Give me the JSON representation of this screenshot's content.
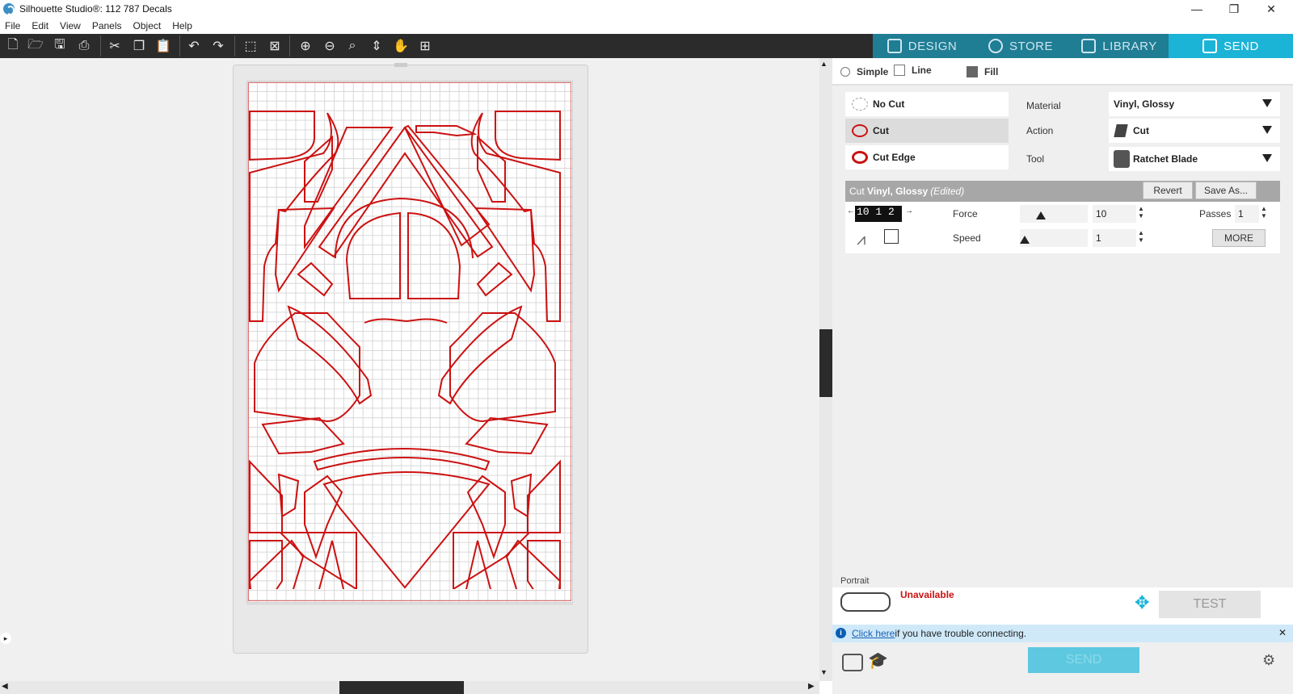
{
  "window": {
    "title": "Silhouette Studio®: 112 787 Decals",
    "minimize": "—",
    "restore": "❐",
    "close": "✕"
  },
  "menu": [
    "File",
    "Edit",
    "View",
    "Panels",
    "Object",
    "Help"
  ],
  "toolbar": {
    "icons": [
      "new-icon",
      "open-icon",
      "save-icon",
      "print-icon",
      "cut-icon",
      "copy-icon",
      "paste-icon",
      "undo-icon",
      "redo-icon",
      "select-all-icon",
      "deselect-icon",
      "zoom-in-icon",
      "zoom-out-icon",
      "zoom-fit-icon",
      "pan-down-icon",
      "hand-icon",
      "fit-page-icon"
    ]
  },
  "nav_tabs": [
    {
      "label": "DESIGN",
      "icon": "design-icon"
    },
    {
      "label": "STORE",
      "icon": "store-icon"
    },
    {
      "label": "LIBRARY",
      "icon": "library-icon"
    },
    {
      "label": "SEND",
      "icon": "send-icon",
      "active": true
    }
  ],
  "send_panel": {
    "modes": [
      "Simple",
      "Line",
      "Fill"
    ],
    "cut_types": [
      "No Cut",
      "Cut",
      "Cut Edge"
    ],
    "selected_cut_type": "Cut",
    "labels": {
      "material": "Material",
      "action": "Action",
      "tool": "Tool"
    },
    "material": "Vinyl, Glossy",
    "action": "Cut",
    "tool": "Ratchet Blade",
    "cut_bar_prefix": "Cut ",
    "cut_bar_material": "Vinyl, Glossy",
    "cut_bar_edited": " (Edited)",
    "revert": "Revert",
    "save_as": "Save As...",
    "blade_depth_display": "10 1 2",
    "force_label": "Force",
    "force_value": "10",
    "speed_label": "Speed",
    "speed_value": "1",
    "passes_label": "Passes",
    "passes_value": "1",
    "more": "MORE",
    "orientation": "Portrait",
    "status": "Unavailable",
    "test": "TEST",
    "trouble_link": "Click here",
    "trouble_text": " if you have trouble connecting.",
    "send": "SEND"
  },
  "colors": {
    "accent": "#1bb3d6",
    "cut_line": "#cc1111",
    "toolbar_bg": "#2b2b2b",
    "nav_bg": "#1f7d94"
  }
}
